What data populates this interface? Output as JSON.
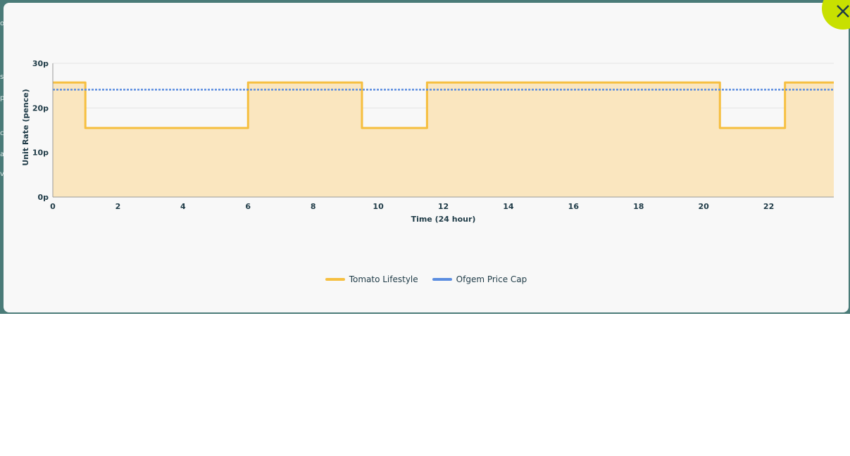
{
  "background": {
    "fragments": [
      "o",
      "s",
      "p",
      "c",
      "a",
      "v"
    ]
  },
  "close_icon": "close-icon",
  "colors": {
    "backdrop": "#4a7b78",
    "modal": "#f8f8f8",
    "close_button": "#c8e000",
    "tariff_line": "#f6bf40",
    "tariff_fill": "#fae6bf",
    "price_cap": "#5b8de0",
    "text": "#1f3b47"
  },
  "chart_data": {
    "type": "line",
    "title": "",
    "xlabel": "Time (24 hour)",
    "ylabel": "Unit Rate (pence)",
    "xlim": [
      0,
      24
    ],
    "ylim": [
      0,
      30
    ],
    "x_ticks": [
      "0",
      "2",
      "4",
      "6",
      "8",
      "10",
      "12",
      "14",
      "16",
      "18",
      "20",
      "22"
    ],
    "x_tick_values": [
      0,
      2,
      4,
      6,
      8,
      10,
      12,
      14,
      16,
      18,
      20,
      22
    ],
    "y_ticks": [
      "0p",
      "10p",
      "20p",
      "30p"
    ],
    "y_tick_values": [
      0,
      10,
      20,
      30
    ],
    "grid": "horizontal",
    "legend": "bottom-center",
    "series": [
      {
        "name": "Tomato Lifestyle",
        "style": "step-area",
        "x": [
          0,
          1,
          1,
          6,
          6,
          9.5,
          9.5,
          11.5,
          11.5,
          20.5,
          20.5,
          22.5,
          22.5,
          24
        ],
        "y": [
          25.7,
          25.7,
          15.5,
          15.5,
          25.7,
          25.7,
          15.5,
          15.5,
          25.7,
          25.7,
          15.5,
          15.5,
          25.7,
          25.7
        ]
      },
      {
        "name": "Ofgem Price Cap",
        "style": "dotted",
        "x": [
          0,
          24
        ],
        "y": [
          24.1,
          24.1
        ]
      }
    ]
  }
}
